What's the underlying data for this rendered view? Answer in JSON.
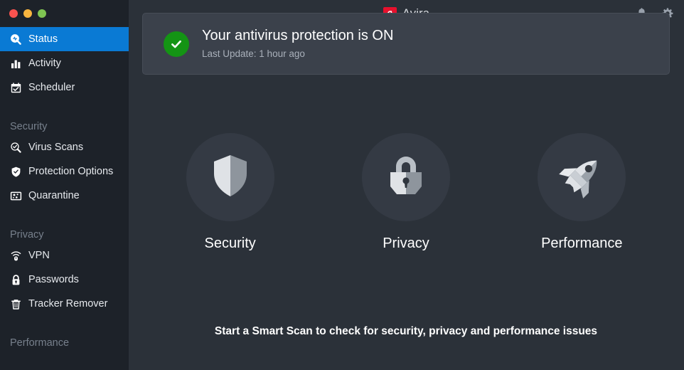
{
  "window": {
    "traffic_lights": [
      {
        "name": "close",
        "color": "#f9534f"
      },
      {
        "name": "minimize",
        "color": "#f9b63f"
      },
      {
        "name": "zoom",
        "color": "#7fc552"
      }
    ]
  },
  "header": {
    "brand_name": "Avira",
    "brand_mark_color": "#e8112d",
    "notifications_icon": "bell-icon",
    "settings_icon": "gear-icon"
  },
  "sidebar": {
    "items": [
      {
        "label": "Status",
        "icon": "search-status-icon",
        "active": true
      },
      {
        "label": "Activity",
        "icon": "bar-chart-icon",
        "active": false
      },
      {
        "label": "Scheduler",
        "icon": "calendar-check-icon",
        "active": false
      }
    ],
    "sections": [
      {
        "title": "Security",
        "items": [
          {
            "label": "Virus Scans",
            "icon": "magnifier-check-icon"
          },
          {
            "label": "Protection Options",
            "icon": "shield-check-icon"
          },
          {
            "label": "Quarantine",
            "icon": "quarantine-box-icon"
          }
        ]
      },
      {
        "title": "Privacy",
        "items": [
          {
            "label": "VPN",
            "icon": "vpn-signal-icon"
          },
          {
            "label": "Passwords",
            "icon": "padlock-icon"
          },
          {
            "label": "Tracker Remover",
            "icon": "trash-icon"
          }
        ]
      },
      {
        "title": "Performance",
        "items": []
      }
    ]
  },
  "main": {
    "status_card": {
      "icon": "green-check-circle-icon",
      "status_color": "#149414",
      "title": "Your antivirus protection is ON",
      "subtitle": "Last Update: 1 hour ago"
    },
    "features": [
      {
        "label": "Security",
        "icon": "shield-icon"
      },
      {
        "label": "Privacy",
        "icon": "padlock-icon"
      },
      {
        "label": "Performance",
        "icon": "rocket-icon"
      }
    ],
    "tagline": "Start a Smart Scan to check for security, privacy and performance issues"
  }
}
